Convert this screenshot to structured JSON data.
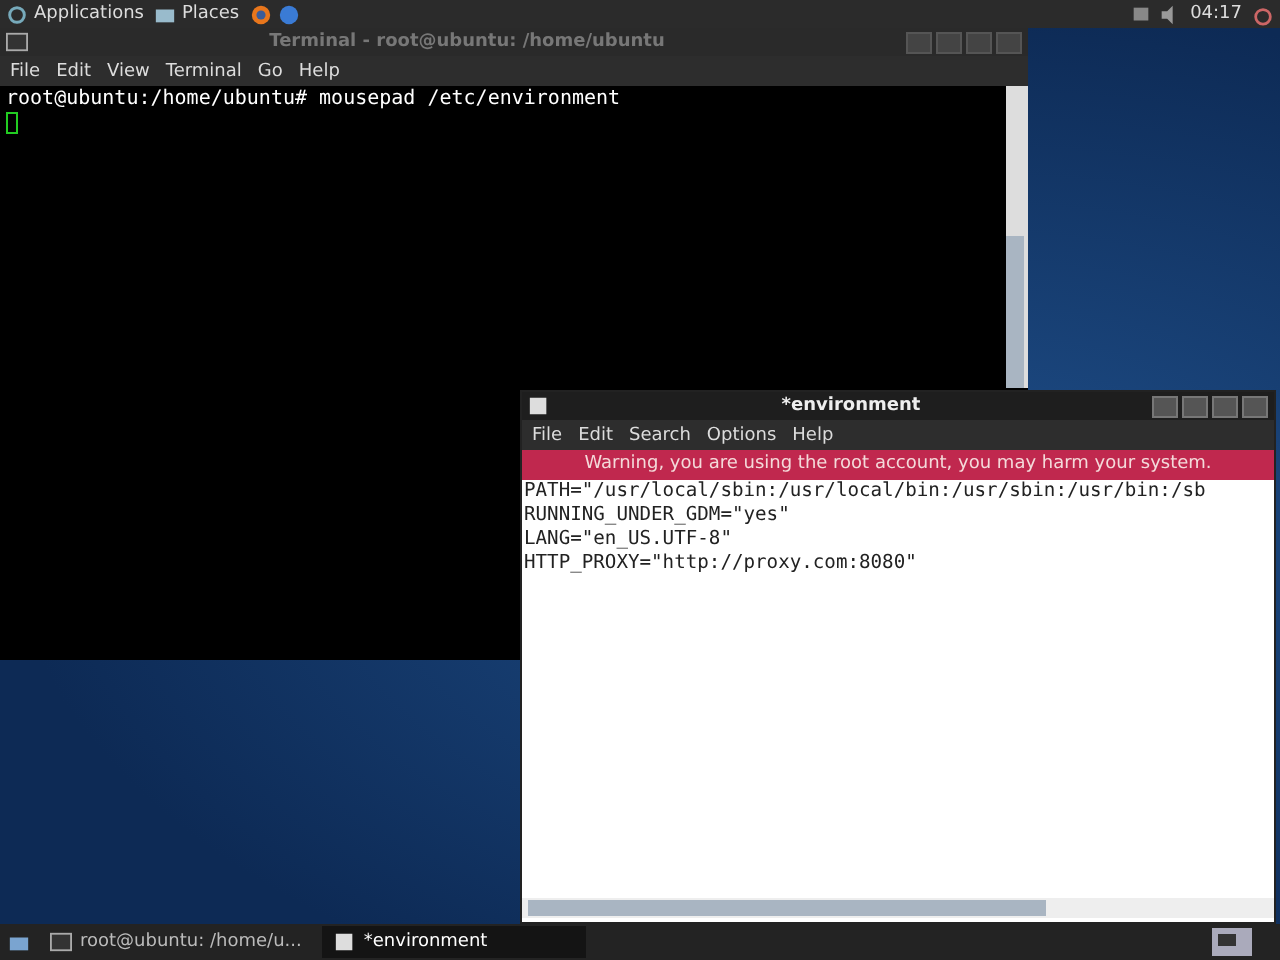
{
  "top_panel": {
    "menus": [
      {
        "label": "Applications"
      },
      {
        "label": "Places"
      }
    ],
    "clock": "04:17"
  },
  "terminal": {
    "title": "Terminal - root@ubuntu: /home/ubuntu",
    "active": false,
    "menu": [
      "File",
      "Edit",
      "View",
      "Terminal",
      "Go",
      "Help"
    ],
    "lines": [
      "root@ubuntu:/home/ubuntu# mousepad /etc/environment"
    ]
  },
  "editor": {
    "title": "*environment",
    "active": true,
    "menu": [
      "File",
      "Edit",
      "Search",
      "Options",
      "Help"
    ],
    "warning": "Warning, you are using the root account, you may harm your system.",
    "lines": [
      "PATH=\"/usr/local/sbin:/usr/local/bin:/usr/sbin:/usr/bin:/sb",
      "RUNNING_UNDER_GDM=\"yes\"",
      "LANG=\"en_US.UTF-8\"",
      "HTTP_PROXY=\"http://proxy.com:8080\""
    ]
  },
  "taskbar": {
    "tasks": [
      {
        "label": "root@ubuntu: /home/u...",
        "kind": "terminal",
        "selected": false
      },
      {
        "label": "*environment",
        "kind": "editor",
        "selected": true
      }
    ]
  }
}
